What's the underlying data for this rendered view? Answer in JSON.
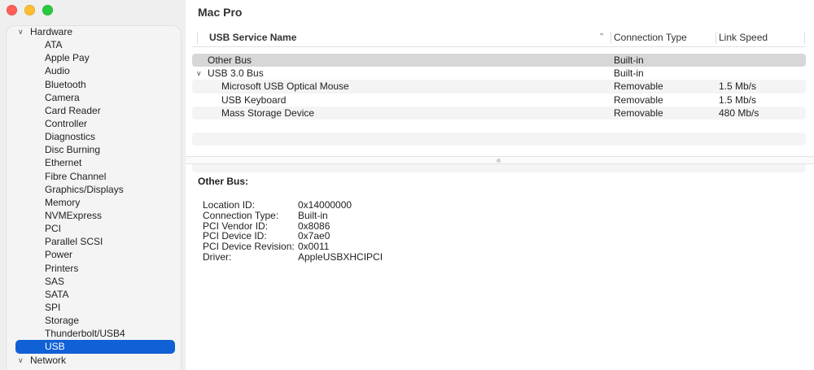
{
  "window": {
    "title": "Mac Pro"
  },
  "sidebar": {
    "groups": [
      {
        "label": "Hardware",
        "expanded": true,
        "items": [
          "ATA",
          "Apple Pay",
          "Audio",
          "Bluetooth",
          "Camera",
          "Card Reader",
          "Controller",
          "Diagnostics",
          "Disc Burning",
          "Ethernet",
          "Fibre Channel",
          "Graphics/Displays",
          "Memory",
          "NVMExpress",
          "PCI",
          "Parallel SCSI",
          "Power",
          "Printers",
          "SAS",
          "SATA",
          "SPI",
          "Storage",
          "Thunderbolt/USB4",
          "USB"
        ],
        "selected": "USB"
      },
      {
        "label": "Network",
        "expanded": true,
        "items": []
      }
    ]
  },
  "table": {
    "columns": {
      "name": "USB Service Name",
      "connection": "Connection Type",
      "speed": "Link Speed",
      "sort_indicator": "^"
    },
    "rows": [
      {
        "name": "Other Bus",
        "connection": "Built-in",
        "speed": "",
        "level": 0,
        "selected": true
      },
      {
        "name": "USB 3.0 Bus",
        "connection": "Built-in",
        "speed": "",
        "level": 0,
        "expandable": true
      },
      {
        "name": "Microsoft USB Optical Mouse",
        "connection": "Removable",
        "speed": "1.5 Mb/s",
        "level": 1
      },
      {
        "name": "USB Keyboard",
        "connection": "Removable",
        "speed": "1.5 Mb/s",
        "level": 1
      },
      {
        "name": "Mass Storage Device",
        "connection": "Removable",
        "speed": "480 Mb/s",
        "level": 1
      }
    ]
  },
  "detail": {
    "title": "Other Bus:",
    "fields": [
      {
        "key": "Location ID:",
        "value": "0x14000000"
      },
      {
        "key": "Connection Type:",
        "value": "Built-in"
      },
      {
        "key": "PCI Vendor ID:",
        "value": "0x8086"
      },
      {
        "key": "PCI Device ID:",
        "value": "0x7ae0"
      },
      {
        "key": "PCI Device Revision:",
        "value": "0x0011"
      },
      {
        "key": "Driver:",
        "value": "AppleUSBXHCIPCI"
      }
    ]
  },
  "icons": {
    "close": "close-window-icon",
    "minimize": "minimize-window-icon",
    "zoom": "zoom-window-icon",
    "disclosure": "chevron-down-icon"
  },
  "colors": {
    "selection": "#1060d6",
    "row_selected": "#d7d7d7",
    "traffic_red": "#fe5f57",
    "traffic_yellow": "#febc2e",
    "traffic_green": "#28c840"
  }
}
